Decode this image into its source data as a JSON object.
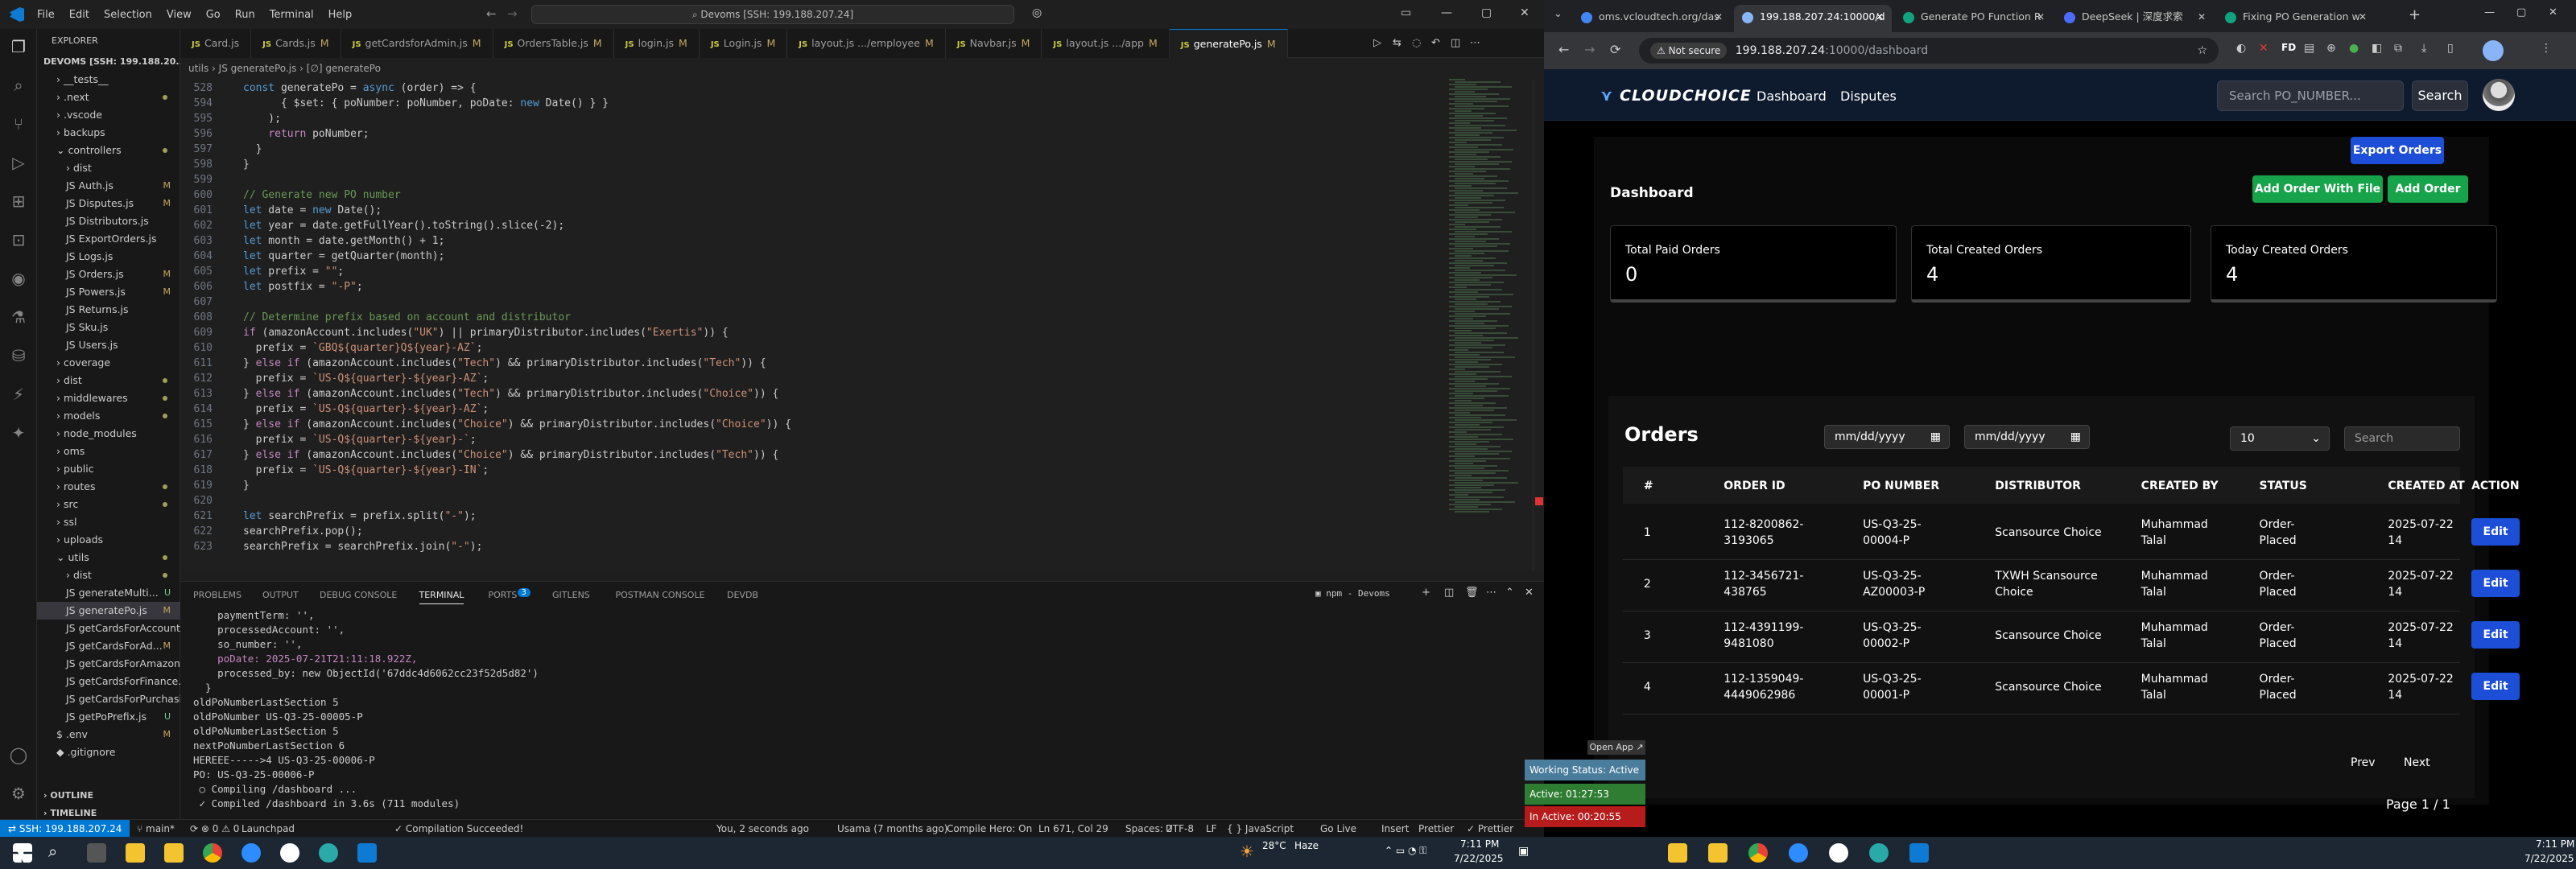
{
  "vscode": {
    "menu": [
      "File",
      "Edit",
      "Selection",
      "View",
      "Go",
      "Run",
      "Terminal",
      "Help"
    ],
    "command_center": "Devoms [SSH: 199.188.207.24]",
    "explorer_title": "EXPLORER",
    "workspace": "DEVOMS [SSH: 199.188.20...",
    "tree": [
      {
        "label": "› __tests__",
        "x": 24,
        "mark": ""
      },
      {
        "label": "› .next",
        "x": 24,
        "mark": "dot"
      },
      {
        "label": "› .vscode",
        "x": 24,
        "mark": ""
      },
      {
        "label": "› backups",
        "x": 24,
        "mark": ""
      },
      {
        "label": "⌄ controllers",
        "x": 24,
        "mark": "dot"
      },
      {
        "label": "› dist",
        "x": 36,
        "mark": ""
      },
      {
        "label": "JS Auth.js",
        "x": 36,
        "mark": "M"
      },
      {
        "label": "JS Disputes.js",
        "x": 36,
        "mark": "M"
      },
      {
        "label": "JS Distributors.js",
        "x": 36,
        "mark": ""
      },
      {
        "label": "JS ExportOrders.js",
        "x": 36,
        "mark": ""
      },
      {
        "label": "JS Logs.js",
        "x": 36,
        "mark": ""
      },
      {
        "label": "JS Orders.js",
        "x": 36,
        "mark": "M"
      },
      {
        "label": "JS Powers.js",
        "x": 36,
        "mark": "M"
      },
      {
        "label": "JS Returns.js",
        "x": 36,
        "mark": ""
      },
      {
        "label": "JS Sku.js",
        "x": 36,
        "mark": ""
      },
      {
        "label": "JS Users.js",
        "x": 36,
        "mark": ""
      },
      {
        "label": "› coverage",
        "x": 24,
        "mark": ""
      },
      {
        "label": "› dist",
        "x": 24,
        "mark": "dot"
      },
      {
        "label": "› middlewares",
        "x": 24,
        "mark": "dot"
      },
      {
        "label": "› models",
        "x": 24,
        "mark": "dot"
      },
      {
        "label": "› node_modules",
        "x": 24,
        "mark": ""
      },
      {
        "label": "› oms",
        "x": 24,
        "mark": ""
      },
      {
        "label": "› public",
        "x": 24,
        "mark": ""
      },
      {
        "label": "› routes",
        "x": 24,
        "mark": "dot"
      },
      {
        "label": "› src",
        "x": 24,
        "mark": "dot"
      },
      {
        "label": "› ssl",
        "x": 24,
        "mark": ""
      },
      {
        "label": "› uploads",
        "x": 24,
        "mark": ""
      },
      {
        "label": "⌄ utils",
        "x": 24,
        "mark": "dot"
      },
      {
        "label": "› dist",
        "x": 36,
        "mark": "dot"
      },
      {
        "label": "JS generateMulti...",
        "x": 36,
        "mark": "U"
      },
      {
        "label": "JS generatePo.js",
        "x": 36,
        "mark": "M",
        "sel": true
      },
      {
        "label": "JS getCardsForAccount.js",
        "x": 36,
        "mark": ""
      },
      {
        "label": "JS getCardsForAd...",
        "x": 36,
        "mark": "M"
      },
      {
        "label": "JS getCardsForAmazon.js",
        "x": 36,
        "mark": ""
      },
      {
        "label": "JS getCardsForFinance.js",
        "x": 36,
        "mark": ""
      },
      {
        "label": "JS getCardsForPurchasi...",
        "x": 36,
        "mark": ""
      },
      {
        "label": "JS getPoPrefix.js",
        "x": 36,
        "mark": "U"
      },
      {
        "label": "$ .env",
        "x": 24,
        "mark": "M"
      },
      {
        "label": "◆ .gitignore",
        "x": 24,
        "mark": ""
      }
    ],
    "outline": "› OUTLINE",
    "timeline": "› TIMELINE",
    "tabs": [
      {
        "name": "Card.js",
        "m": ""
      },
      {
        "name": "Cards.js",
        "m": "M"
      },
      {
        "name": "getCardsforAdmin.js",
        "m": "M"
      },
      {
        "name": "OrdersTable.js",
        "m": "M"
      },
      {
        "name": "login.js",
        "m": "M"
      },
      {
        "name": "Login.js",
        "m": "M"
      },
      {
        "name": "layout.js .../employee",
        "m": "M"
      },
      {
        "name": "Navbar.js",
        "m": "M"
      },
      {
        "name": "layout.js .../app",
        "m": "M"
      },
      {
        "name": "generatePo.js",
        "m": "M",
        "active": true
      }
    ],
    "breadcrumb": "utils › JS generatePo.js › [∅] generatePo",
    "code_lines": [
      {
        "n": "528",
        "t": "const generatePo = async (order) => {"
      },
      {
        "n": "594",
        "t": "      { $set: { poNumber: poNumber, poDate: new Date() } }"
      },
      {
        "n": "595",
        "t": "    );"
      },
      {
        "n": "596",
        "t": "    return poNumber;"
      },
      {
        "n": "597",
        "t": "  }"
      },
      {
        "n": "598",
        "t": "}"
      },
      {
        "n": "599",
        "t": ""
      },
      {
        "n": "600",
        "t": "// Generate new PO number"
      },
      {
        "n": "601",
        "t": "let date = new Date();"
      },
      {
        "n": "602",
        "t": "let year = date.getFullYear().toString().slice(-2);"
      },
      {
        "n": "603",
        "t": "let month = date.getMonth() + 1;"
      },
      {
        "n": "604",
        "t": "let quarter = getQuarter(month);"
      },
      {
        "n": "605",
        "t": "let prefix = \"\";"
      },
      {
        "n": "606",
        "t": "let postfix = \"-P\";"
      },
      {
        "n": "607",
        "t": ""
      },
      {
        "n": "608",
        "t": "// Determine prefix based on account and distributor"
      },
      {
        "n": "609",
        "t": "if (amazonAccount.includes(\"UK\") || primaryDistributor.includes(\"Exertis\")) {"
      },
      {
        "n": "610",
        "t": "  prefix = `GBQ${quarter}Q${year}-AZ`;"
      },
      {
        "n": "611",
        "t": "} else if (amazonAccount.includes(\"Tech\") && primaryDistributor.includes(\"Tech\")) {"
      },
      {
        "n": "612",
        "t": "  prefix = `US-Q${quarter}-${year}-AZ`;"
      },
      {
        "n": "613",
        "t": "} else if (amazonAccount.includes(\"Tech\") && primaryDistributor.includes(\"Choice\")) {"
      },
      {
        "n": "614",
        "t": "  prefix = `US-Q${quarter}-${year}-AZ`;"
      },
      {
        "n": "615",
        "t": "} else if (amazonAccount.includes(\"Choice\") && primaryDistributor.includes(\"Choice\")) {"
      },
      {
        "n": "616",
        "t": "  prefix = `US-Q${quarter}-${year}-`;"
      },
      {
        "n": "617",
        "t": "} else if (amazonAccount.includes(\"Choice\") && primaryDistributor.includes(\"Tech\")) {"
      },
      {
        "n": "618",
        "t": "  prefix = `US-Q${quarter}-${year}-IN`;"
      },
      {
        "n": "619",
        "t": "}"
      },
      {
        "n": "620",
        "t": ""
      },
      {
        "n": "621",
        "t": "let searchPrefix = prefix.split(\"-\");"
      },
      {
        "n": "622",
        "t": "searchPrefix.pop();"
      },
      {
        "n": "623",
        "t": "searchPrefix = searchPrefix.join(\"-\");"
      }
    ],
    "panel_tabs": [
      "PROBLEMS",
      "OUTPUT",
      "DEBUG CONSOLE",
      "TERMINAL",
      "PORTS",
      "GITLENS",
      "POSTMAN CONSOLE",
      "DEVDB"
    ],
    "ports_badge": "3",
    "terminal_label": "npm - Devoms",
    "terminal_lines": [
      "    paymentTerm: '',",
      "    processedAccount: '',",
      "    so_number: '',",
      "    poDate: 2025-07-21T21:11:18.922Z,",
      "    processed_by: new ObjectId('67ddc4d6062cc23f52d5d82')",
      "  }",
      "oldPoNumberLastSection 5",
      "oldPoNumber US-Q3-25-00005-P",
      "oldPoNumberLastSection 5",
      "nextPoNumberLastSection 6",
      "HEREEE----->4 US-Q3-25-00006-P",
      "PO: US-Q3-25-00006-P",
      " ○ Compiling /dashboard ...",
      " ✓ Compiled /dashboard in 3.6s (711 modules)"
    ],
    "status": {
      "remote": "⇄ SSH: 199.188.207.24",
      "branch": "⑂ main*",
      "sync": "⟳ ⊗ 0 ⚠ 0",
      "launchpad": "Launchpad",
      "compilation": "✓ Compilation Succeeded!",
      "blame": "You, 2 seconds ago",
      "author": "Usama (7 months ago)",
      "compile_hero": "Compile Hero: On",
      "position": "Ln 671, Col 29",
      "spaces": "Spaces: 2",
      "encoding": "UTF-8",
      "eol": "LF",
      "language": "{ } JavaScript",
      "golive": "Go Live",
      "insert": "Insert",
      "prettier": "Prettier",
      "prettier2": "✓ Prettier"
    }
  },
  "chrome": {
    "tabs": [
      {
        "title": "oms.vcloudtech.org/das",
        "color": "#4285f4"
      },
      {
        "title": "199.188.207.24:10000/d",
        "color": "#8ab4f8",
        "active": true
      },
      {
        "title": "Generate PO Function R",
        "color": "#10a37f"
      },
      {
        "title": "DeepSeek | 深度求索",
        "color": "#4d6bfe"
      },
      {
        "title": "Fixing PO Generation w",
        "color": "#10a37f"
      }
    ],
    "not_secure": "⚠ Not secure",
    "url_host": "199.188.207.24",
    "url_path": ":10000/dashboard"
  },
  "app": {
    "brand": "CLOUDCHOICE",
    "nav": [
      "Dashboard",
      "Disputes"
    ],
    "search_placeholder": "Search PO_NUMBER...",
    "search_btn": "Search",
    "export_btn": "Export Orders",
    "page_title": "Dashboard",
    "add_file_btn": "Add Order With File",
    "add_btn": "Add Order",
    "cards": [
      {
        "title": "Total Paid Orders",
        "value": "0"
      },
      {
        "title": "Total Created Orders",
        "value": "4"
      },
      {
        "title": "Today Created Orders",
        "value": "4"
      }
    ],
    "orders_title": "Orders",
    "date_placeholder": "mm/dd/yyyy",
    "page_size": "10",
    "table_search": "Search",
    "columns": [
      "#",
      "ORDER ID",
      "PO NUMBER",
      "DISTRIBUTOR",
      "CREATED BY",
      "STATUS",
      "CREATED AT",
      "ACTION"
    ],
    "rows": [
      {
        "n": "1",
        "order_id": [
          "112-8200862-",
          "3193065"
        ],
        "po": [
          "US-Q3-25-",
          "00004-P"
        ],
        "dist": [
          "Scansource Choice",
          ""
        ],
        "by": [
          "Muhammad",
          "Talal"
        ],
        "status": [
          "Order-",
          "Placed"
        ],
        "at": [
          "2025-07-22",
          "14"
        ]
      },
      {
        "n": "2",
        "order_id": [
          "112-3456721-",
          "438765"
        ],
        "po": [
          "US-Q3-25-",
          "AZ00003-P"
        ],
        "dist": [
          "TXWH Scansource",
          "Choice"
        ],
        "by": [
          "Muhammad",
          "Talal"
        ],
        "status": [
          "Order-",
          "Placed"
        ],
        "at": [
          "2025-07-22",
          "14"
        ]
      },
      {
        "n": "3",
        "order_id": [
          "112-4391199-",
          "9481080"
        ],
        "po": [
          "US-Q3-25-",
          "00002-P"
        ],
        "dist": [
          "Scansource Choice",
          ""
        ],
        "by": [
          "Muhammad",
          "Talal"
        ],
        "status": [
          "Order-",
          "Placed"
        ],
        "at": [
          "2025-07-22",
          "14"
        ]
      },
      {
        "n": "4",
        "order_id": [
          "112-1359049-",
          "4449062986"
        ],
        "po": [
          "US-Q3-25-",
          "00001-P"
        ],
        "dist": [
          "Scansource Choice",
          ""
        ],
        "by": [
          "Muhammad",
          "Talal"
        ],
        "status": [
          "Order-",
          "Placed"
        ],
        "at": [
          "2025-07-22",
          "14"
        ]
      }
    ],
    "edit": "Edit",
    "prev": "Prev",
    "next": "Next",
    "page": "Page 1 / 1"
  },
  "overlay": {
    "open_app": "Open App ↗",
    "working": "Working Status: Active",
    "active": "Active: 01:27:53",
    "inactive": "In Active: 00:20:55"
  },
  "taskbar": {
    "weather_temp": "28°C",
    "weather_desc": "Haze",
    "left_time": "7:11 PM",
    "left_date": "7/22/2025",
    "right_time": "7:11 PM",
    "right_date": "7/22/2025"
  }
}
